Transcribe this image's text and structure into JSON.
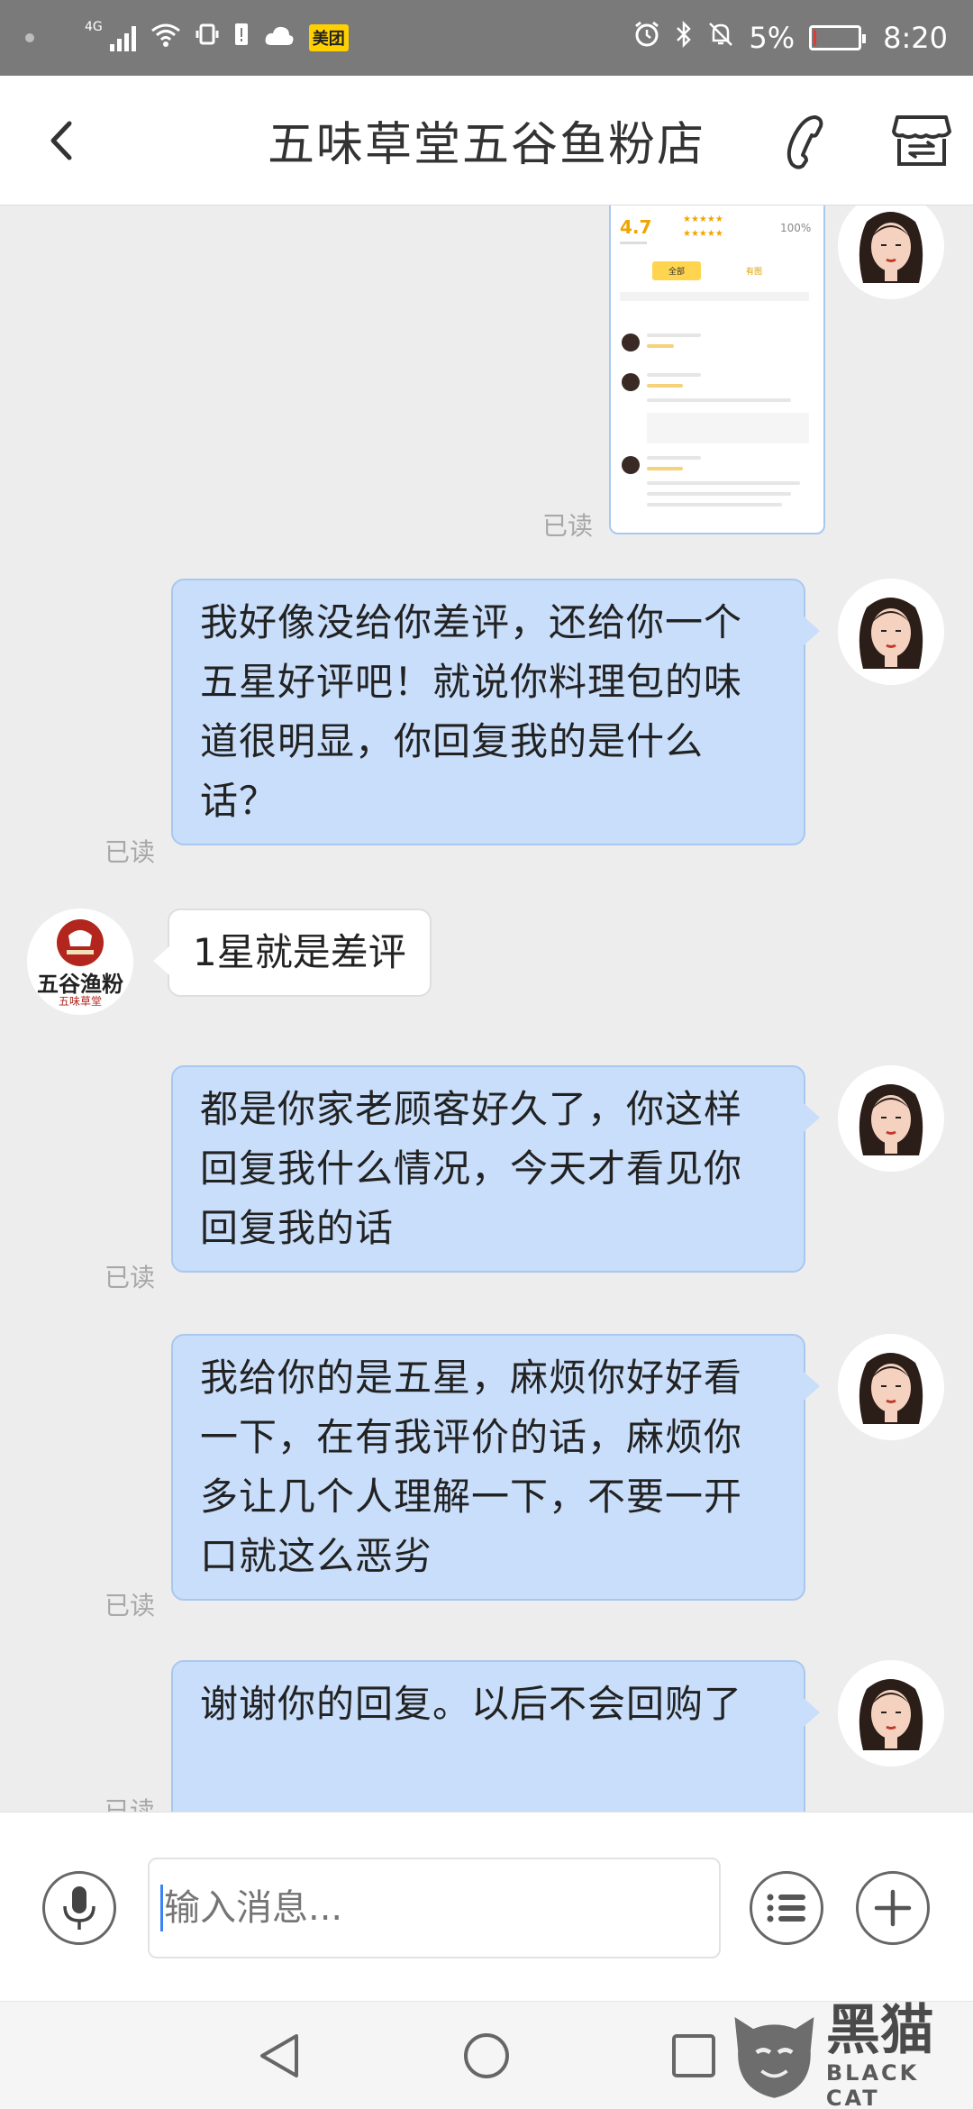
{
  "status_bar": {
    "network": "4G",
    "app_badge": "美团",
    "battery": "5%",
    "battery_level": 0.05,
    "time": "8:20"
  },
  "header": {
    "title": "五味草堂五谷鱼粉店",
    "back_icon": "chevron-left-icon",
    "phone_icon": "phone-icon",
    "shop_icon": "shop-icon"
  },
  "screenshot_thumb": {
    "rating": "4.7",
    "positive_rate": "100%",
    "tabs": [
      "全部",
      "有图"
    ]
  },
  "messages": [
    {
      "side": "out",
      "type": "image",
      "status": "已读"
    },
    {
      "side": "out",
      "type": "text",
      "text": "我好像没给你差评，还给你一个五星好评吧！就说你料理包的味道很明显，你回复我的是什么话？",
      "status": "已读"
    },
    {
      "side": "in",
      "type": "text",
      "text": "1星就是差评"
    },
    {
      "side": "out",
      "type": "text",
      "text": "都是你家老顾客好久了，你这样回复我什么情况，今天才看见你回复我的话",
      "status": "已读"
    },
    {
      "side": "out",
      "type": "text",
      "text": "我给你的是五星，麻烦你好好看一下，在有我评价的话，麻烦你多让几个人理解一下，不要一开口就这么恶劣",
      "status": "已读"
    },
    {
      "side": "out",
      "type": "text",
      "text": "谢谢你的回复。以后不会回购了",
      "status": "已读"
    }
  ],
  "shop_logo": {
    "line1": "五谷渔粉",
    "line2": "五味草堂"
  },
  "input_bar": {
    "placeholder": "输入消息...",
    "mic_icon": "microphone-icon",
    "menu_icon": "list-menu-icon",
    "plus_icon": "plus-icon"
  },
  "nav_bar": {
    "back_icon": "triangle-back-icon",
    "home_icon": "circle-home-icon",
    "recents_icon": "square-recents-icon"
  },
  "watermark": {
    "cn": "黑猫",
    "en": "BLACK CAT"
  },
  "colors": {
    "bubble_out": "#c9defa",
    "bubble_in": "#ffffff",
    "status_bar": "#7a7a7a",
    "chat_bg": "#ededed"
  }
}
